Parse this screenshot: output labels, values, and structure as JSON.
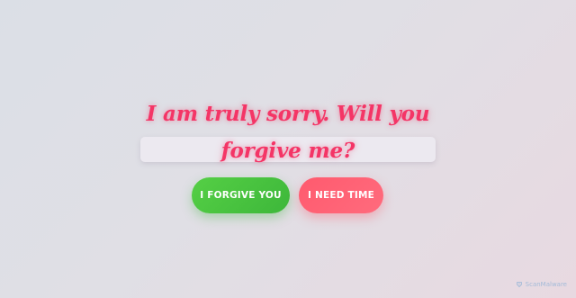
{
  "message": {
    "text": "I am truly sorry. Will you forgive me?"
  },
  "buttons": {
    "forgive_label": "I FORGIVE YOU",
    "time_label": "I NEED TIME"
  },
  "watermark": {
    "text": "ScanMalware",
    "icon": "scanmalware-logo-icon"
  },
  "colors": {
    "message": "#f43566",
    "forgive_button": "#48c43d",
    "time_button": "#ff5f72",
    "background": "#dedfe6"
  }
}
